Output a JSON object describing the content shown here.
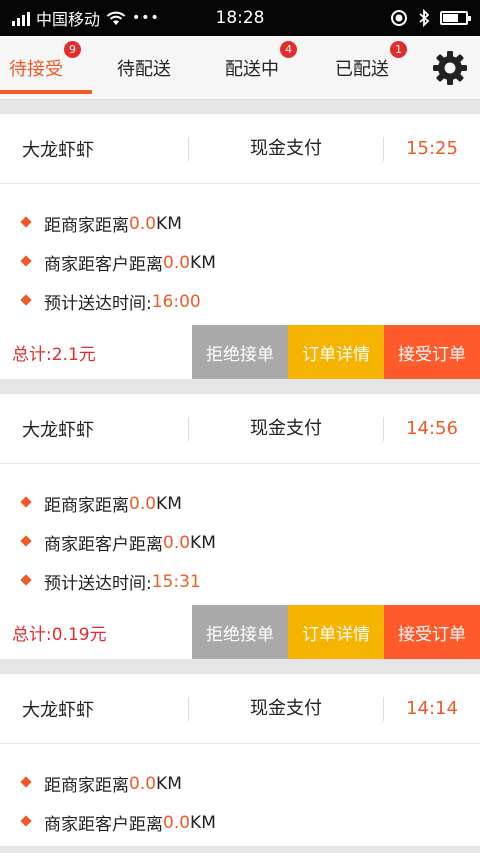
{
  "status_bar": {
    "carrier": "中国移动",
    "more": "•••",
    "time": "18:28",
    "battery_level": 0.7
  },
  "tabs": [
    {
      "label": "待接受",
      "badge": "9",
      "active": true
    },
    {
      "label": "待配送",
      "badge": "",
      "active": false
    },
    {
      "label": "配送中",
      "badge": "4",
      "active": false
    },
    {
      "label": "已配送",
      "badge": "1",
      "active": false
    }
  ],
  "settings_icon": "gear-icon",
  "labels": {
    "distance_shop": "距商家距离",
    "distance_customer": "商家距客户距离",
    "km_unit": "KM",
    "eta": "预计送达时间:",
    "total_prefix": "总计:",
    "reject": "拒绝接单",
    "detail": "订单详情",
    "accept": "接受订单"
  },
  "orders": [
    {
      "shop": "大龙虾虾",
      "payment": "现金支付",
      "time": "15:25",
      "distance_shop": "0.0",
      "distance_customer": "0.0",
      "eta": "16:00",
      "total": "2.1元"
    },
    {
      "shop": "大龙虾虾",
      "payment": "现金支付",
      "time": "14:56",
      "distance_shop": "0.0",
      "distance_customer": "0.0",
      "eta": "15:31",
      "total": "0.19元"
    },
    {
      "shop": "大龙虾虾",
      "payment": "现金支付",
      "time": "14:14",
      "distance_shop": "0.0",
      "distance_customer": "0.0",
      "eta": "",
      "total": ""
    }
  ],
  "colors": {
    "accent": "#f05a28",
    "badge": "#e52c2c",
    "reject_button": "#a9a9a9",
    "detail_button": "#f5b400",
    "accept_button": "#ff5a2c"
  }
}
